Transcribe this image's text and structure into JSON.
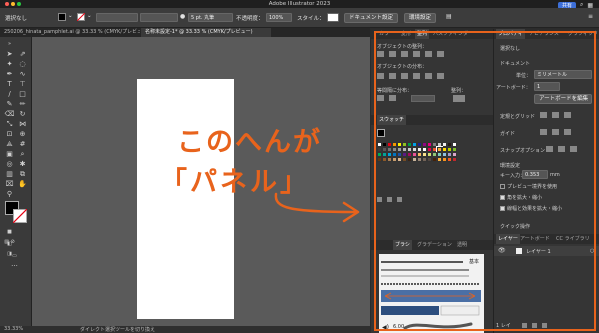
{
  "window": {
    "title": "Adobe Illustrator 2023",
    "share_label": "共有"
  },
  "control_bar": {
    "selection_label": "選択なし",
    "stroke_weight": "5 pt. 丸筆",
    "opacity_label": "不透明度：",
    "opacity_value": "100%",
    "style_label": "スタイル：",
    "doc_setup_button": "ドキュメント設定",
    "prefs_button": "環境設定"
  },
  "doc_tabs": [
    {
      "label": "250206_hinata_pamphlet.ai @ 33.33 % (CMYK/プレビュー)",
      "active": false
    },
    {
      "label": "名称未設定-1* @ 33.33 % (CMYK/プレビュー)",
      "active": true
    }
  ],
  "status_bar": {
    "zoom": "33.33%",
    "tool_hint": "ダイレクト選択ツールを切り換え"
  },
  "annotation": {
    "line1": "このへんが",
    "line2": "「パネル」"
  },
  "align_panel": {
    "tabs": [
      "カラー",
      "変形",
      "整列",
      "パスファインダー"
    ],
    "active_tab": "整列",
    "obj_align_label": "オブジェクトの整列：",
    "obj_distribute_label": "オブジェクトの分布：",
    "spacing_label": "等間隔に分布：",
    "align_to_label": "整列："
  },
  "swatches_panel": {
    "title": "スウォッチ",
    "colors": [
      "#ffffff",
      "#000000",
      "#e60012",
      "#f39800",
      "#fff100",
      "#8fc31f",
      "#009944",
      "#00a0e9",
      "#1d2088",
      "#920783",
      "#e4007f",
      "#7f7f7f",
      "#c9caca",
      "#f0f0f0",
      "#231815",
      "#ffffff",
      "#3e3a39",
      "#595757",
      "#727171",
      "#898989",
      "#9fa0a0",
      "#b5b5b6",
      "#c9caca",
      "#dcdddd",
      "#efefef",
      "#ffffff",
      "#e5004f",
      "#ea5532",
      "#f6ad3c",
      "#ffd900",
      "#b8d200",
      "#7fbe26",
      "#00ae50",
      "#00a29a",
      "#00a3d9",
      "#0075c2",
      "#1d50a2",
      "#5f1985",
      "#a40b5d",
      "#e95295",
      "#f8b862",
      "#f6e08c",
      "#d3de73",
      "#8fc876",
      "#7fccbc",
      "#8dbfe0",
      "#a29bca",
      "#d7a6c9",
      "#603813",
      "#8b5a2b",
      "#a67c52",
      "#c69c6d",
      "#d9b48f",
      "#754c24",
      "#3c2415",
      "#c7b299",
      "#998675",
      "#736357",
      "#534741",
      "#42210b",
      "#fbb03b",
      "#f7931e",
      "#f15a24",
      "#c1272d"
    ],
    "selected_index": 28
  },
  "brush_panel": {
    "tabs": [
      "ブラシ",
      "グラデーション",
      "透明"
    ],
    "active_tab": "ブラシ",
    "basic_label": "基本",
    "size_value": "6.00"
  },
  "properties_panel": {
    "tabs": [
      "プロパティ",
      "アピアランス",
      "グラフィック"
    ],
    "active_tab": "プロパティ",
    "no_selection": "選択なし",
    "document_label": "ドキュメント",
    "units_label": "単位：",
    "units_value": "ミリメートル",
    "artboard_label": "アートボード：",
    "artboard_value": "1",
    "edit_artboard_button": "アートボードを編集",
    "rulers_grid_label": "定規とグリッド",
    "guides_label": "ガイド",
    "snap_label": "スナップオプション",
    "prefs_label": "環境設定",
    "key_input_label": "キー入力：",
    "key_input_value": "0.353",
    "key_input_unit": "mm",
    "options": [
      {
        "label": "プレビュー境界を使用",
        "checked": false
      },
      {
        "label": "角を拡大・縮小",
        "checked": true
      },
      {
        "label": "線幅と効果を拡大・縮小",
        "checked": true
      }
    ],
    "quick_actions_label": "クイック操作"
  },
  "layers_panel": {
    "tabs": [
      "レイヤー",
      "アートボード",
      "CC ライブラリ"
    ],
    "active_tab": "レイヤー",
    "layer_name": "レイヤー 1",
    "footer_label": "1 レイ"
  },
  "colors": {
    "accent_orange": "#e8631c",
    "share_blue": "#3d6fd8"
  }
}
